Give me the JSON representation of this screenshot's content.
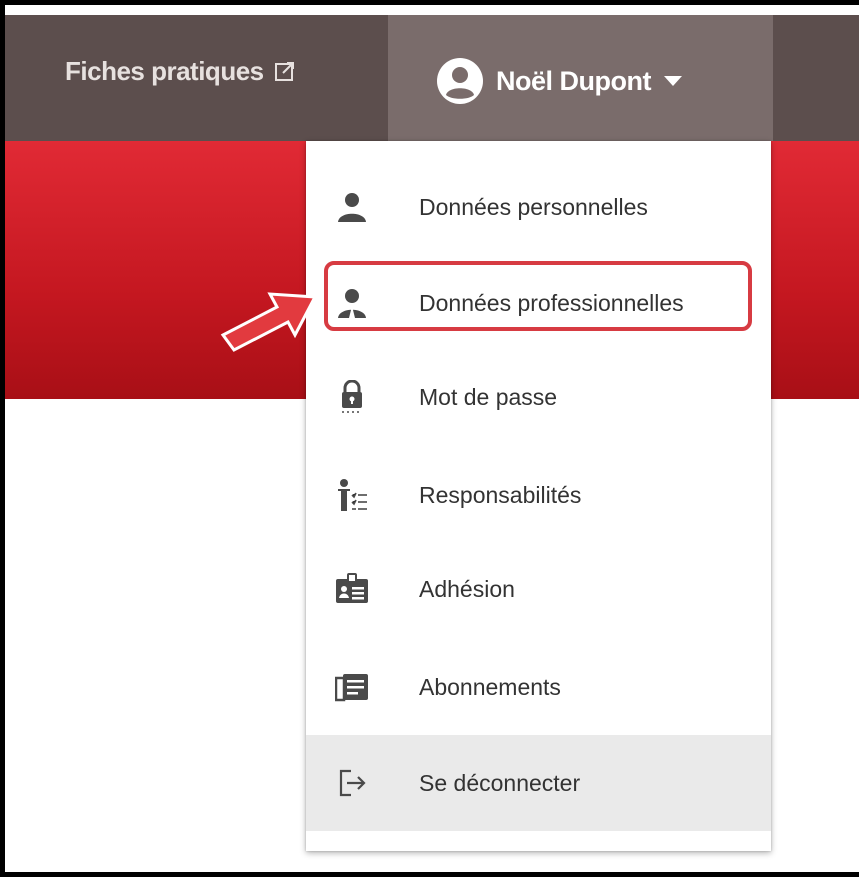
{
  "header": {
    "link_label": "Fiches pratiques",
    "user_name": "Noël Dupont"
  },
  "menu": {
    "items": [
      {
        "label": "Données personnelles",
        "icon": "person-icon"
      },
      {
        "label": "Données professionnelles",
        "icon": "professional-person-icon"
      },
      {
        "label": "Mot de passe",
        "icon": "lock-icon"
      },
      {
        "label": "Responsabilités",
        "icon": "responsibilities-icon"
      },
      {
        "label": "Adhésion",
        "icon": "member-card-icon"
      },
      {
        "label": "Abonnements",
        "icon": "newspaper-icon"
      },
      {
        "label": "Se déconnecter",
        "icon": "logout-icon"
      }
    ],
    "highlighted_item": "Données professionnelles",
    "hovered_item": "Se déconnecter"
  },
  "colors": {
    "topbar": "#5c4e4d",
    "user_tab": "#7a6c6b",
    "red_band": "#c41720",
    "highlight": "#d73b42"
  }
}
